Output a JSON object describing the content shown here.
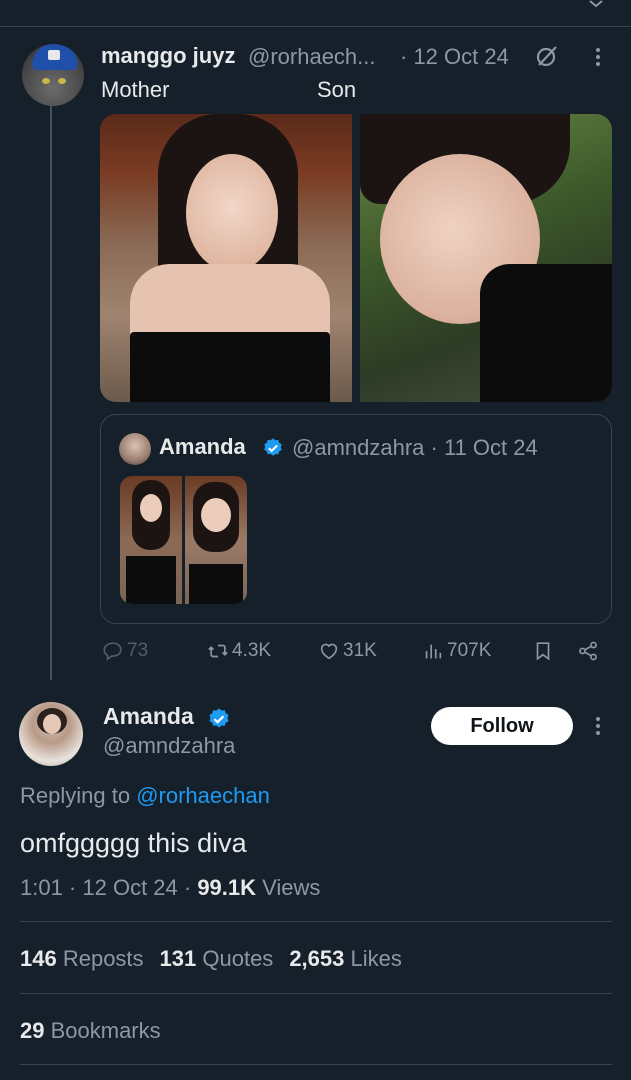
{
  "parent_tweet": {
    "display_name": "manggo juyz",
    "handle": "@rorhaech...",
    "date": "· 12 Oct 24",
    "media_labels": [
      "Mother",
      "Son"
    ],
    "quote": {
      "display_name": "Amanda",
      "handle": "@amndzahra",
      "date": "· 11 Oct 24"
    },
    "actions": {
      "replies": "73",
      "reposts": "4.3K",
      "likes": "31K",
      "views": "707K"
    }
  },
  "main_tweet": {
    "display_name": "Amanda",
    "handle": "@amndzahra",
    "follow_label": "Follow",
    "replying_prefix": "Replying to ",
    "replying_to": "@rorhaechan",
    "text": "omfggggg this diva",
    "time": "1:01 · 12 Oct 24 · ",
    "views_count": "99.1K",
    "views_label": " Views",
    "stats": {
      "reposts_count": "146",
      "reposts_label": " Reposts",
      "quotes_count": "131",
      "quotes_label": " Quotes",
      "likes_count": "2,653",
      "likes_label": " Likes",
      "bookmarks_count": "29",
      "bookmarks_label": " Bookmarks"
    }
  },
  "colors": {
    "background": "#15202b",
    "accent": "#1d9bf0",
    "text_primary": "#e7e9ea",
    "text_secondary": "#8b98a5",
    "border": "#38444d"
  }
}
